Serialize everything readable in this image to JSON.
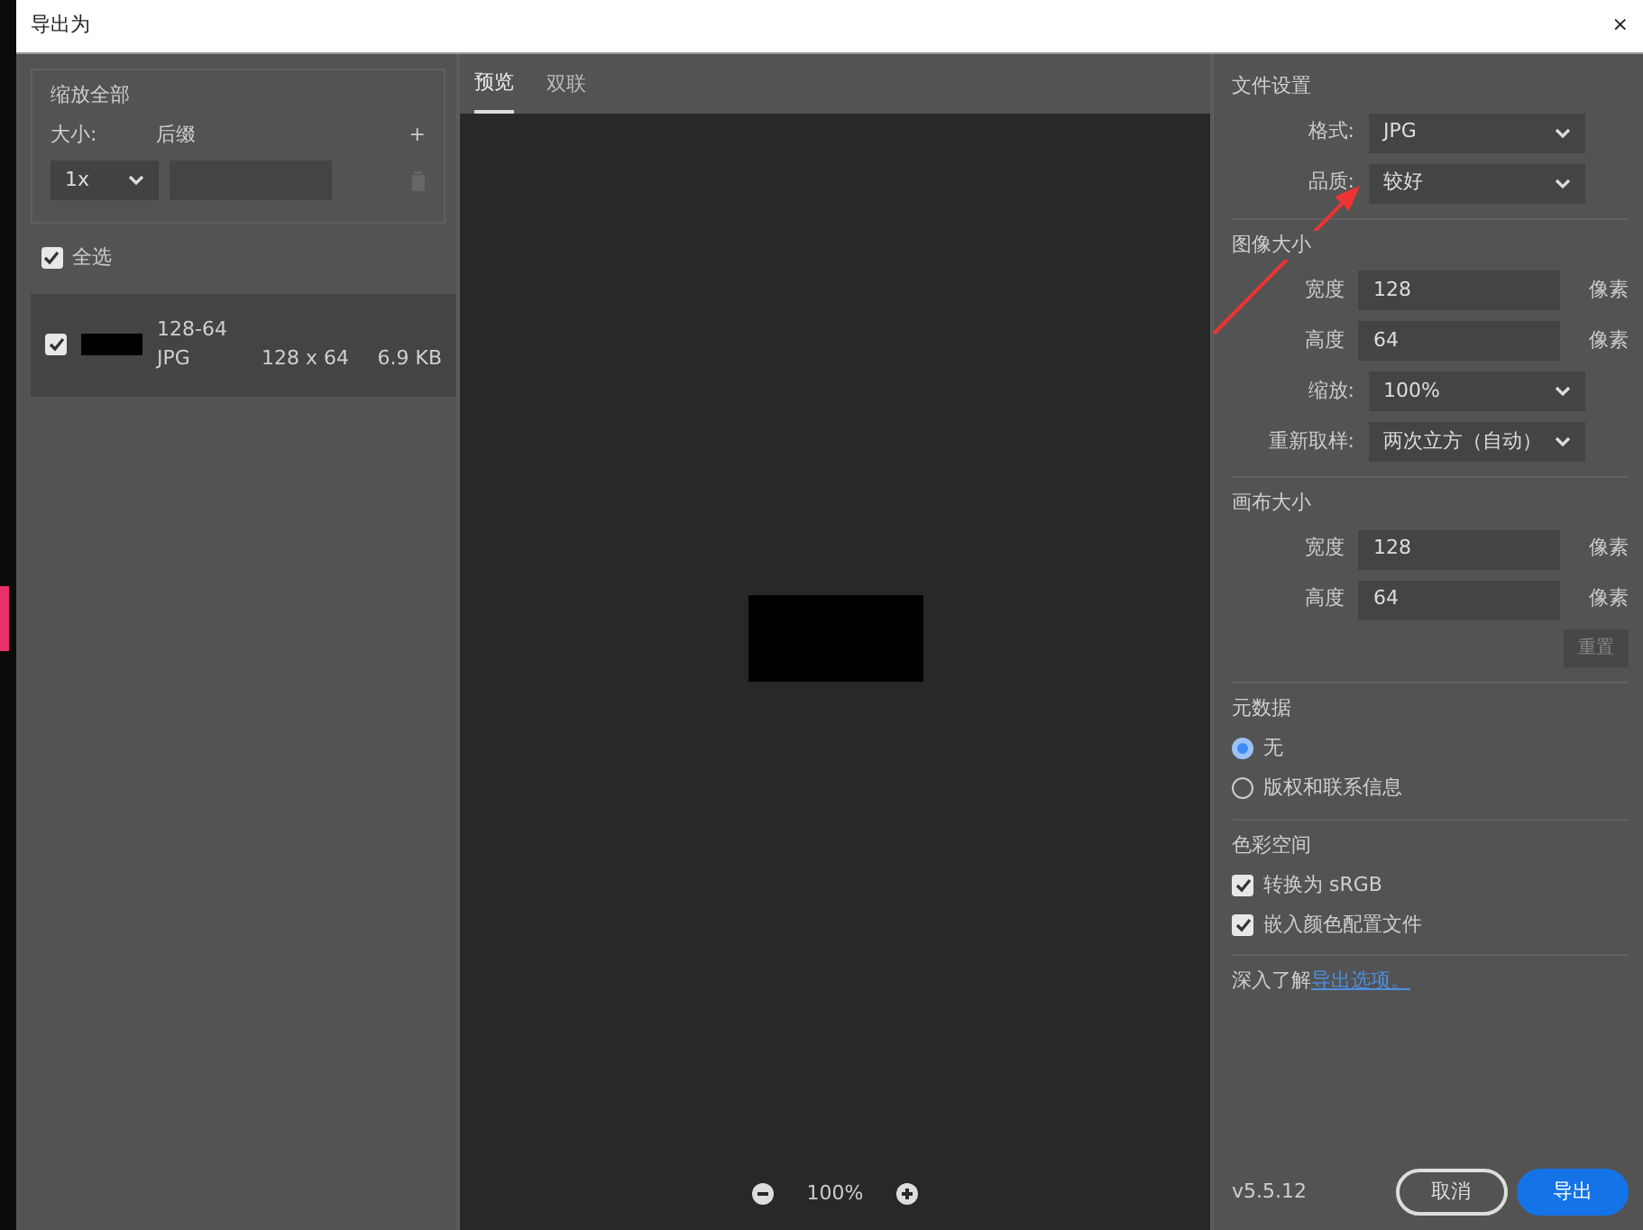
{
  "window": {
    "title": "导出为",
    "close": "×"
  },
  "left": {
    "scale_header": "缩放全部",
    "size_label": "大小:",
    "suffix_label": "后缀",
    "add": "+",
    "scale_value": "1x",
    "select_all": {
      "label": "全选",
      "checked": true
    },
    "assets": [
      {
        "name": "128-64",
        "format": "JPG",
        "dimensions": "128 x 64",
        "filesize": "6.9 KB",
        "checked": true,
        "selected": true
      }
    ]
  },
  "preview": {
    "tabs": [
      {
        "label": "预览",
        "selected": true
      },
      {
        "label": "双联",
        "selected": false
      }
    ],
    "zoom": "100%"
  },
  "settings": {
    "sections": [
      {
        "title": "文件设置",
        "rows": [
          {
            "kind": "select",
            "label": "格式:",
            "value": "JPG"
          },
          {
            "kind": "select",
            "label": "品质:",
            "value": "较好"
          }
        ]
      },
      {
        "title": "图像大小",
        "rows": [
          {
            "kind": "input",
            "label": "宽度",
            "value": "128",
            "unit": "像素"
          },
          {
            "kind": "input",
            "label": "高度",
            "value": "64",
            "unit": "像素"
          },
          {
            "kind": "select",
            "label": "缩放:",
            "value": "100%"
          },
          {
            "kind": "select",
            "label": "重新取样:",
            "value": "两次立方（自动）"
          }
        ]
      },
      {
        "title": "画布大小",
        "rows": [
          {
            "kind": "input",
            "label": "宽度",
            "value": "128",
            "unit": "像素"
          },
          {
            "kind": "input",
            "label": "高度",
            "value": "64",
            "unit": "像素"
          }
        ],
        "reset": "重置"
      },
      {
        "title": "元数据",
        "radios": [
          {
            "label": "无",
            "selected": true
          },
          {
            "label": "版权和联系信息",
            "selected": false
          }
        ]
      },
      {
        "title": "色彩空间",
        "checks": [
          {
            "label": "转换为 sRGB",
            "checked": true
          },
          {
            "label": "嵌入颜色配置文件",
            "checked": true
          }
        ]
      }
    ],
    "learn_more": {
      "text": "深入了解",
      "link": "导出选项。"
    }
  },
  "footer": {
    "version": "v5.5.12",
    "buttons": [
      {
        "kind": "secondary",
        "label": "取消"
      },
      {
        "kind": "primary",
        "label": "导出"
      }
    ]
  }
}
